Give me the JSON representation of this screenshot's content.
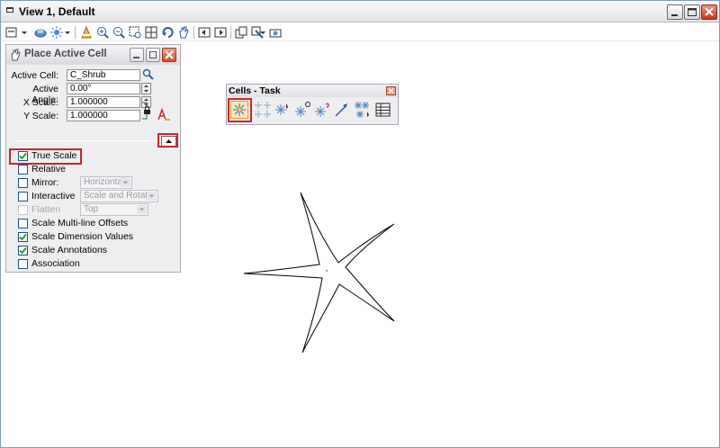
{
  "window": {
    "title": "View 1, Default"
  },
  "toolbar": {
    "icons": [
      "view-attributes-icon",
      "levels-icon",
      "display-style-icon",
      "update-icon",
      "zoom-in-icon",
      "zoom-out-icon",
      "window-area-icon",
      "fit-view-icon",
      "rotate-view-icon",
      "pan-icon",
      "view-previous-icon",
      "view-next-icon",
      "copy-view-icon",
      "clip-volume-icon",
      "camera-icon"
    ]
  },
  "place_cell": {
    "title": "Place Active Cell",
    "active_cell_label": "Active Cell:",
    "active_cell_value": "C_Shrub",
    "active_angle_label": "Active Angle:",
    "active_angle_value": "0.00°",
    "x_scale_label": "X Scale:",
    "x_scale_value": "1.000000",
    "y_scale_label": "Y Scale:",
    "y_scale_value": "1.000000",
    "options": [
      {
        "label": "True Scale",
        "checked": true,
        "enabled": true
      },
      {
        "label": "Relative",
        "checked": false,
        "enabled": true
      },
      {
        "label": "Mirror:",
        "checked": false,
        "enabled": true,
        "select": "Horizontal"
      },
      {
        "label": "Interactive",
        "checked": false,
        "enabled": true,
        "select": "Scale and Rotate"
      },
      {
        "label": "Flatten",
        "checked": false,
        "enabled": false,
        "select": "Top"
      },
      {
        "label": "Scale Multi-line Offsets",
        "checked": false,
        "enabled": true
      },
      {
        "label": "Scale Dimension Values",
        "checked": true,
        "enabled": true
      },
      {
        "label": "Scale Annotations",
        "checked": true,
        "enabled": true
      },
      {
        "label": "Association",
        "checked": false,
        "enabled": true
      }
    ]
  },
  "cells_task": {
    "title": "Cells - Task",
    "tools": [
      "place-active-cell-icon",
      "place-active-cell-matrix-icon",
      "select-and-place-cell-icon",
      "define-cell-origin-icon",
      "identify-cell-icon",
      "place-active-line-terminator-icon",
      "replace-cells-icon",
      "cell-library-table-icon"
    ]
  },
  "colors": {
    "highlight": "#c3272d",
    "accent": "#1c5180"
  }
}
